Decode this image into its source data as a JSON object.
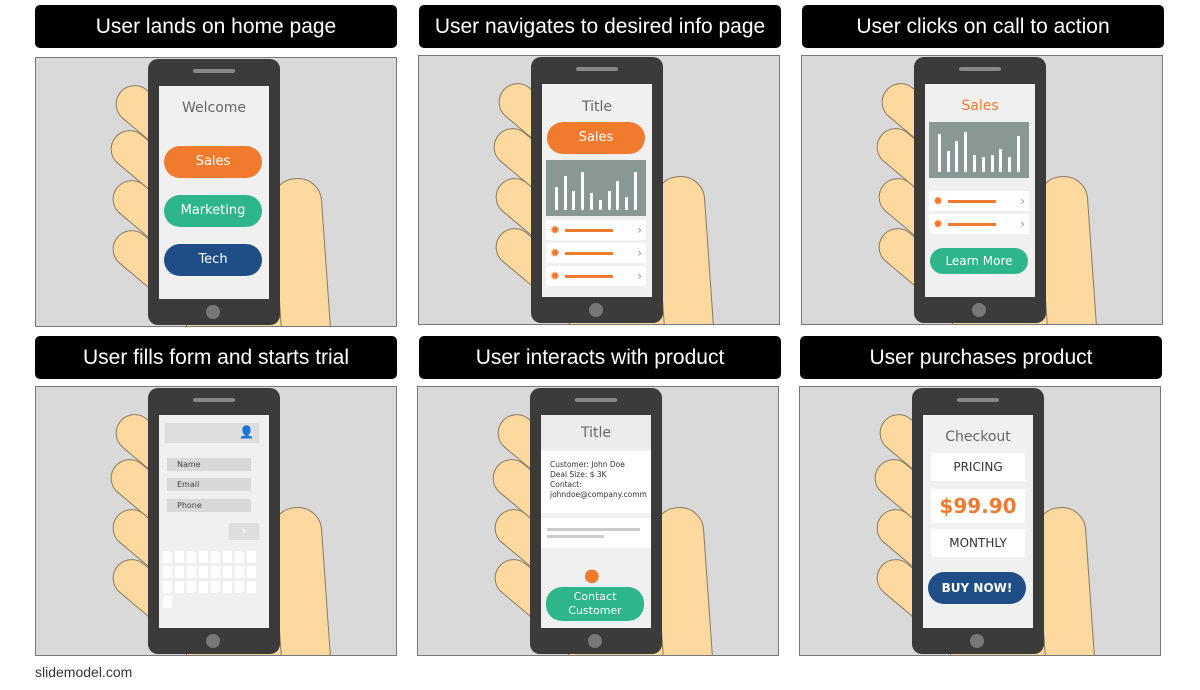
{
  "steps": [
    {
      "title": "User lands on home page",
      "welcome": "Welcome",
      "buttons": [
        "Sales",
        "Marketing",
        "Tech"
      ]
    },
    {
      "title": "User navigates to desired info page",
      "screen_title": "Title",
      "button": "Sales",
      "chart_levels": [
        0.55,
        0.8,
        0.45,
        0.9,
        0.4,
        0.25,
        0.45,
        0.7,
        0.3,
        0.9
      ]
    },
    {
      "title": "User clicks on call to action",
      "screen_title": "Sales",
      "button": "Learn More",
      "chart_levels": [
        0.9,
        0.5,
        0.75,
        0.95,
        0.4,
        0.35,
        0.4,
        0.55,
        0.35,
        0.85
      ]
    },
    {
      "title": "User fills form and starts trial",
      "fields": [
        "Name",
        "Email",
        "Phone"
      ]
    },
    {
      "title": "User interacts with product",
      "screen_title": "Title",
      "info": [
        "Customer: John Doe",
        "Deal Size: $ 3K",
        "Contact:",
        "johndoe@company.comm"
      ],
      "button": "Contact Customer"
    },
    {
      "title": "User purchases product",
      "screen_title": "Checkout",
      "pricing": "PRICING",
      "price": "$99.90",
      "period": "MONTHLY",
      "button": "BUY NOW!"
    }
  ],
  "colors": {
    "orange": "#f07a2e",
    "green": "#2fb58b",
    "navy": "#1f4e86"
  },
  "footer": "slidemodel.com"
}
